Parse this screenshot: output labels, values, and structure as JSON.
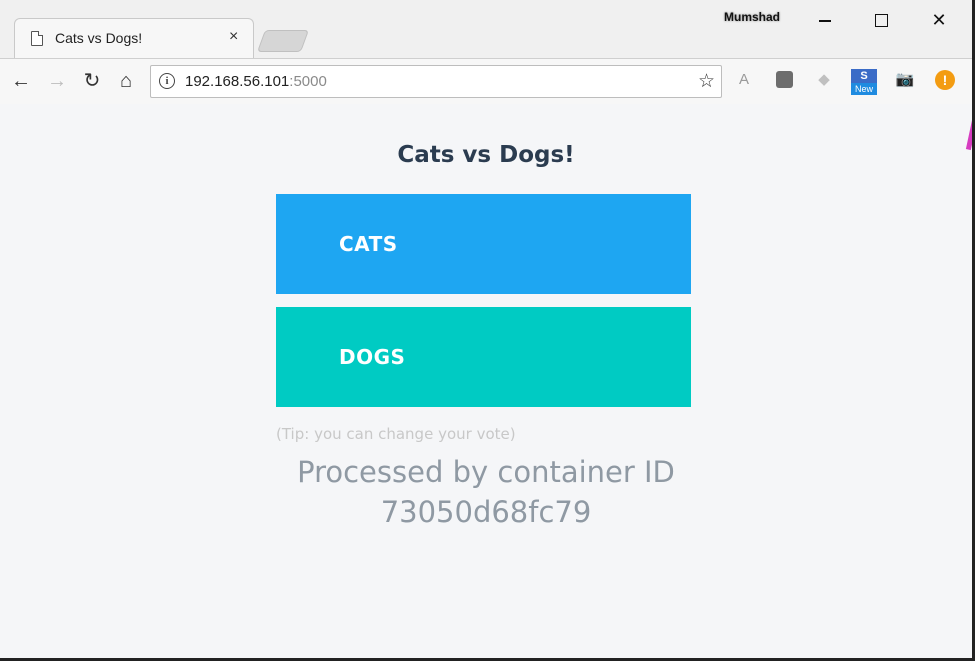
{
  "browser": {
    "tab": {
      "title": "Cats vs Dogs!",
      "close_glyph": "×"
    },
    "profile_name": "Mumshad",
    "window_controls": {
      "close_glyph": "✕"
    },
    "nav": {
      "back_glyph": "←",
      "forward_glyph": "→",
      "reload_glyph": "↻",
      "home_glyph": "⌂"
    },
    "address": {
      "host": "192.168.56.101",
      "port": ":5000",
      "info_glyph": "i",
      "star_glyph": "☆"
    },
    "extensions": [
      {
        "name": "angular-icon",
        "glyph": "A"
      },
      {
        "name": "extension-box-icon",
        "glyph": ""
      },
      {
        "name": "vue-devtools-icon",
        "glyph": "◆"
      },
      {
        "name": "new-extension-icon",
        "glyph_top": "S",
        "glyph_bottom": "New"
      },
      {
        "name": "camera-icon",
        "glyph": "📷"
      },
      {
        "name": "alert-icon",
        "glyph": "!"
      }
    ]
  },
  "page": {
    "heading": "Cats vs Dogs!",
    "options": [
      {
        "label": "CATS",
        "color": "#1ea6f2"
      },
      {
        "label": "DOGS",
        "color": "#00cbc3"
      }
    ],
    "tip": "(Tip: you can change your vote)",
    "processed_line1": "Processed by container ID",
    "processed_line2": "73050d68fc79"
  }
}
